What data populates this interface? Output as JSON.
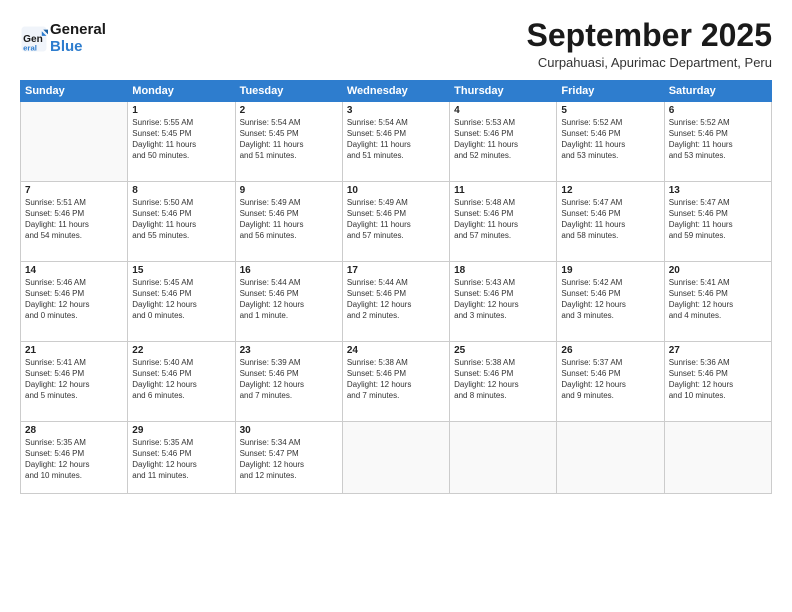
{
  "logo": {
    "line1": "General",
    "line2": "Blue"
  },
  "title": "September 2025",
  "subtitle": "Curpahuasi, Apurimac Department, Peru",
  "days_of_week": [
    "Sunday",
    "Monday",
    "Tuesday",
    "Wednesday",
    "Thursday",
    "Friday",
    "Saturday"
  ],
  "weeks": [
    [
      {
        "num": "",
        "info": ""
      },
      {
        "num": "1",
        "info": "Sunrise: 5:55 AM\nSunset: 5:45 PM\nDaylight: 11 hours\nand 50 minutes."
      },
      {
        "num": "2",
        "info": "Sunrise: 5:54 AM\nSunset: 5:45 PM\nDaylight: 11 hours\nand 51 minutes."
      },
      {
        "num": "3",
        "info": "Sunrise: 5:54 AM\nSunset: 5:46 PM\nDaylight: 11 hours\nand 51 minutes."
      },
      {
        "num": "4",
        "info": "Sunrise: 5:53 AM\nSunset: 5:46 PM\nDaylight: 11 hours\nand 52 minutes."
      },
      {
        "num": "5",
        "info": "Sunrise: 5:52 AM\nSunset: 5:46 PM\nDaylight: 11 hours\nand 53 minutes."
      },
      {
        "num": "6",
        "info": "Sunrise: 5:52 AM\nSunset: 5:46 PM\nDaylight: 11 hours\nand 53 minutes."
      }
    ],
    [
      {
        "num": "7",
        "info": "Sunrise: 5:51 AM\nSunset: 5:46 PM\nDaylight: 11 hours\nand 54 minutes."
      },
      {
        "num": "8",
        "info": "Sunrise: 5:50 AM\nSunset: 5:46 PM\nDaylight: 11 hours\nand 55 minutes."
      },
      {
        "num": "9",
        "info": "Sunrise: 5:49 AM\nSunset: 5:46 PM\nDaylight: 11 hours\nand 56 minutes."
      },
      {
        "num": "10",
        "info": "Sunrise: 5:49 AM\nSunset: 5:46 PM\nDaylight: 11 hours\nand 57 minutes."
      },
      {
        "num": "11",
        "info": "Sunrise: 5:48 AM\nSunset: 5:46 PM\nDaylight: 11 hours\nand 57 minutes."
      },
      {
        "num": "12",
        "info": "Sunrise: 5:47 AM\nSunset: 5:46 PM\nDaylight: 11 hours\nand 58 minutes."
      },
      {
        "num": "13",
        "info": "Sunrise: 5:47 AM\nSunset: 5:46 PM\nDaylight: 11 hours\nand 59 minutes."
      }
    ],
    [
      {
        "num": "14",
        "info": "Sunrise: 5:46 AM\nSunset: 5:46 PM\nDaylight: 12 hours\nand 0 minutes."
      },
      {
        "num": "15",
        "info": "Sunrise: 5:45 AM\nSunset: 5:46 PM\nDaylight: 12 hours\nand 0 minutes."
      },
      {
        "num": "16",
        "info": "Sunrise: 5:44 AM\nSunset: 5:46 PM\nDaylight: 12 hours\nand 1 minute."
      },
      {
        "num": "17",
        "info": "Sunrise: 5:44 AM\nSunset: 5:46 PM\nDaylight: 12 hours\nand 2 minutes."
      },
      {
        "num": "18",
        "info": "Sunrise: 5:43 AM\nSunset: 5:46 PM\nDaylight: 12 hours\nand 3 minutes."
      },
      {
        "num": "19",
        "info": "Sunrise: 5:42 AM\nSunset: 5:46 PM\nDaylight: 12 hours\nand 3 minutes."
      },
      {
        "num": "20",
        "info": "Sunrise: 5:41 AM\nSunset: 5:46 PM\nDaylight: 12 hours\nand 4 minutes."
      }
    ],
    [
      {
        "num": "21",
        "info": "Sunrise: 5:41 AM\nSunset: 5:46 PM\nDaylight: 12 hours\nand 5 minutes."
      },
      {
        "num": "22",
        "info": "Sunrise: 5:40 AM\nSunset: 5:46 PM\nDaylight: 12 hours\nand 6 minutes."
      },
      {
        "num": "23",
        "info": "Sunrise: 5:39 AM\nSunset: 5:46 PM\nDaylight: 12 hours\nand 7 minutes."
      },
      {
        "num": "24",
        "info": "Sunrise: 5:38 AM\nSunset: 5:46 PM\nDaylight: 12 hours\nand 7 minutes."
      },
      {
        "num": "25",
        "info": "Sunrise: 5:38 AM\nSunset: 5:46 PM\nDaylight: 12 hours\nand 8 minutes."
      },
      {
        "num": "26",
        "info": "Sunrise: 5:37 AM\nSunset: 5:46 PM\nDaylight: 12 hours\nand 9 minutes."
      },
      {
        "num": "27",
        "info": "Sunrise: 5:36 AM\nSunset: 5:46 PM\nDaylight: 12 hours\nand 10 minutes."
      }
    ],
    [
      {
        "num": "28",
        "info": "Sunrise: 5:35 AM\nSunset: 5:46 PM\nDaylight: 12 hours\nand 10 minutes."
      },
      {
        "num": "29",
        "info": "Sunrise: 5:35 AM\nSunset: 5:46 PM\nDaylight: 12 hours\nand 11 minutes."
      },
      {
        "num": "30",
        "info": "Sunrise: 5:34 AM\nSunset: 5:47 PM\nDaylight: 12 hours\nand 12 minutes."
      },
      {
        "num": "",
        "info": ""
      },
      {
        "num": "",
        "info": ""
      },
      {
        "num": "",
        "info": ""
      },
      {
        "num": "",
        "info": ""
      }
    ]
  ]
}
